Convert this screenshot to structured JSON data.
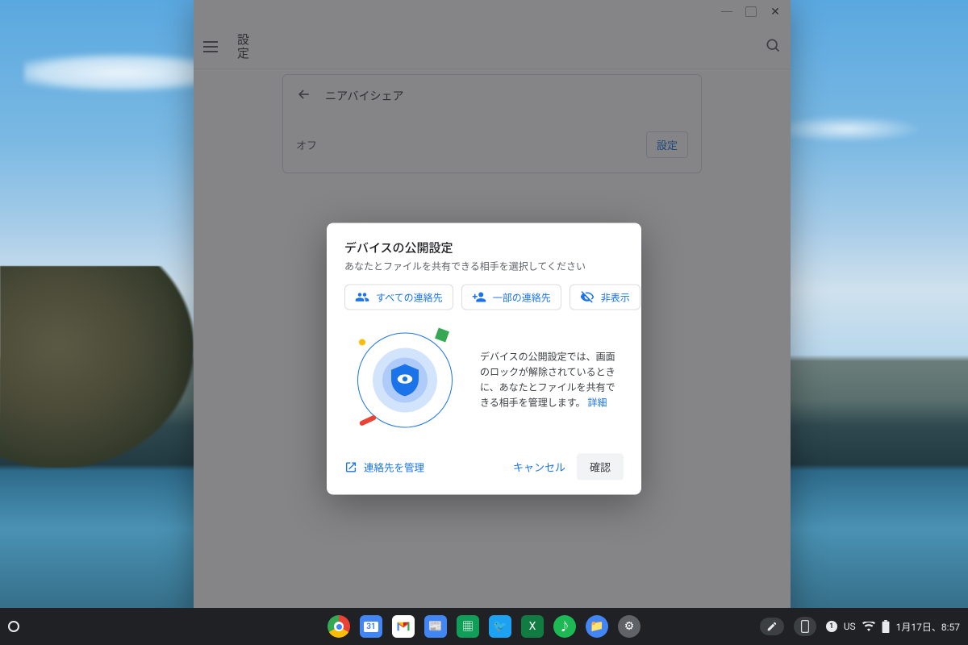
{
  "window": {
    "app_title": "設定",
    "page_header": "ニアバイシェア",
    "status_text": "オフ",
    "settings_button": "設定"
  },
  "dialog": {
    "title": "デバイスの公開設定",
    "subtitle": "あなたとファイルを共有できる相手を選択してください",
    "chips": {
      "all_contacts": "すべての連絡先",
      "some_contacts": "一部の連絡先",
      "hidden": "非表示"
    },
    "description": "デバイスの公開設定では、画面のロックが解除されているときに、あなたとファイルを共有できる相手を管理します。",
    "learn_more": "詳細",
    "manage_contacts": "連絡先を管理",
    "cancel": "キャンセル",
    "confirm": "確認"
  },
  "shelf": {
    "ime_badge": "1",
    "ime_lang": "US",
    "datetime": "1月17日、8:57"
  }
}
